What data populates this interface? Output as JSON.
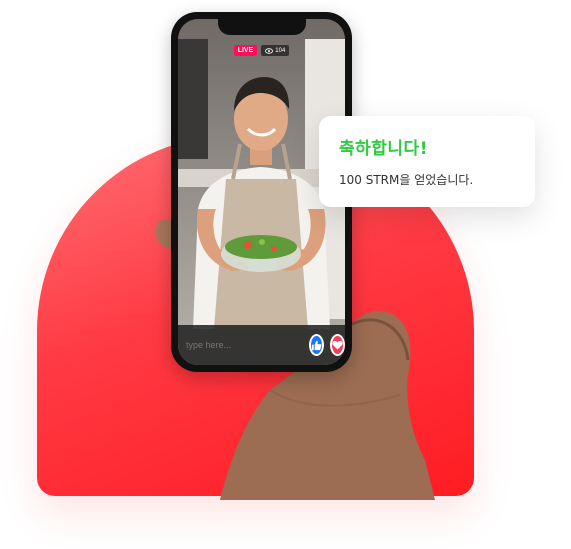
{
  "stream": {
    "live_label": "LIVE",
    "viewer_count": "104",
    "chat_placeholder": "type here..."
  },
  "notification": {
    "title": "축하합니다!",
    "message": "100 STRM을 얻었습니다."
  },
  "icons": {
    "viewers": "eye-icon",
    "like": "thumbs-up-icon",
    "heart": "heart-icon"
  },
  "colors": {
    "accent_red": "#ff2a35",
    "live_badge": "#ff0f5a",
    "success_green": "#2ecc40",
    "like_blue": "#1877f2",
    "heart_red": "#f33e58"
  }
}
